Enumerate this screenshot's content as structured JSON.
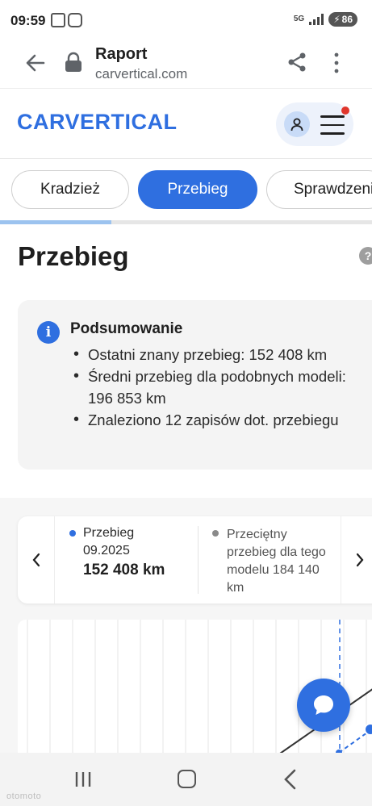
{
  "status_bar": {
    "time": "09:59",
    "network": "5G",
    "battery": "86"
  },
  "browser": {
    "page_name": "Raport",
    "url": "carvertical.com"
  },
  "site": {
    "logo": "CARVERTICAL"
  },
  "tabs": [
    {
      "label": "Kradzież",
      "active": false
    },
    {
      "label": "Przebieg",
      "active": true
    },
    {
      "label": "Sprawdzenie",
      "active": false
    }
  ],
  "tabs_scroll_progress": 0.3,
  "section": {
    "title": "Przebieg",
    "help": "?"
  },
  "summary": {
    "info": "i",
    "title": "Podsumowanie",
    "items": [
      "Ostatni znany przebieg: 152 408 km",
      "Średni przebieg dla podobnych modeli: 196 853 km",
      "Znaleziono 12 zapisów dot. przebiegu"
    ]
  },
  "legend": {
    "series_label": "Przebieg",
    "series_date": "09.2025",
    "series_value": "152 408 km",
    "average_label": "Przeciętny przebieg dla tego modelu 184 140 km"
  },
  "colors": {
    "brand": "#2f6fe0",
    "tab_active": "#2f6fe0",
    "notification": "#e0362c"
  },
  "watermark": "otomoto"
}
